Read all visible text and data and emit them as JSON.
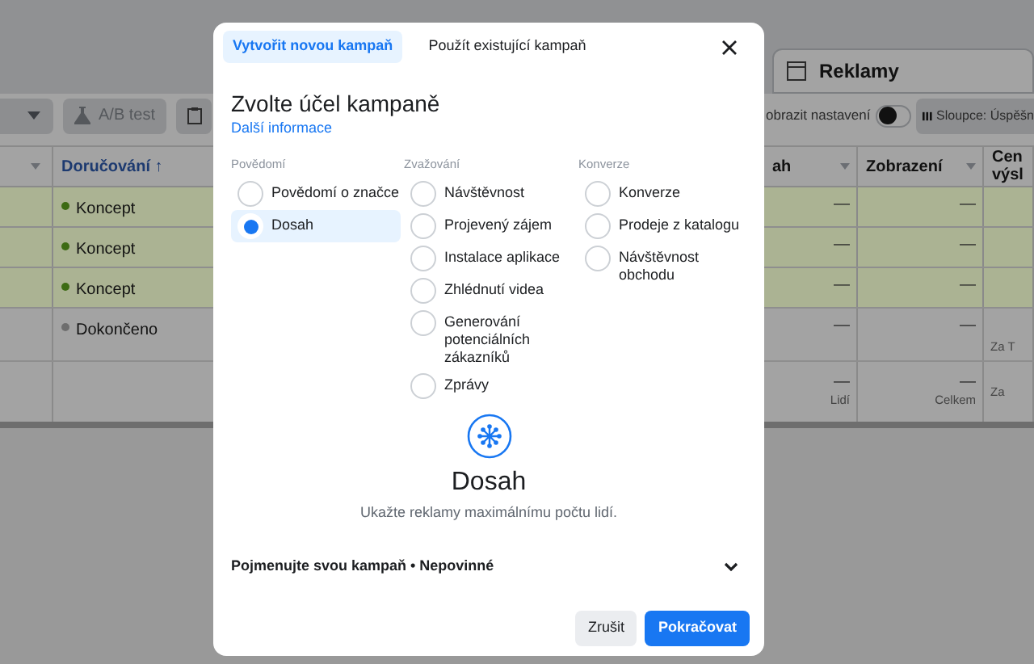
{
  "background": {
    "tab": {
      "label": "Reklamy"
    },
    "toolbar": {
      "ab_test": "A/B test",
      "settings_label": "obrazit nastavení",
      "settings_on": false,
      "columns_button": "Sloupce: Úspěšn"
    },
    "table": {
      "columns": [
        {
          "label": "Doručování ↑",
          "sorted": true
        },
        {
          "label": "ah",
          "sorted": false
        },
        {
          "label": "Zobrazení",
          "sorted": false
        },
        {
          "label": "Cen\nvýsl",
          "sorted": false
        }
      ],
      "rows": [
        {
          "color": "#3d6b14",
          "highlighted": true,
          "cells": [
            "Koncept",
            "—",
            "—",
            ""
          ]
        },
        {
          "color": "#3d6b14",
          "highlighted": true,
          "cells": [
            "Koncept",
            "—",
            "—",
            ""
          ]
        },
        {
          "color": "#3d6b14",
          "highlighted": true,
          "cells": [
            "Koncept",
            "—",
            "—",
            ""
          ]
        },
        {
          "color": "#6e6e6e",
          "highlighted": false,
          "cells": [
            "Dokončeno",
            "—",
            "—",
            "Za T"
          ]
        }
      ],
      "totals": [
        {
          "value": "—",
          "caption": "Lidí"
        },
        {
          "value": "—",
          "caption": "Celkem"
        },
        {
          "caption": "Za"
        }
      ]
    }
  },
  "modal": {
    "tabs": [
      {
        "label": "Vytvořit novou kampaň",
        "selected": true
      },
      {
        "label": "Použít existující kampaň",
        "selected": false
      }
    ],
    "title": "Zvolte účel kampaně",
    "link": "Další informace",
    "groups": [
      {
        "label": "Povědomí",
        "options": [
          {
            "label": "Povědomí o značce",
            "selected": false
          },
          {
            "label": "Dosah",
            "selected": true
          }
        ]
      },
      {
        "label": "Zvažování",
        "options": [
          {
            "label": "Návštěvnost",
            "selected": false
          },
          {
            "label": "Projevený zájem",
            "selected": false
          },
          {
            "label": "Instalace aplikace",
            "selected": false
          },
          {
            "label": "Zhlédnutí videa",
            "selected": false
          },
          {
            "label": "Generování potenciálních zákazníků",
            "selected": false
          },
          {
            "label": "Zprávy",
            "selected": false
          }
        ]
      },
      {
        "label": "Konverze",
        "options": [
          {
            "label": "Konverze",
            "selected": false
          },
          {
            "label": "Prodeje z katalogu",
            "selected": false
          },
          {
            "label": "Návštěvnost obchodu",
            "selected": false
          }
        ]
      }
    ],
    "detail": {
      "title": "Dosah",
      "description": "Ukažte reklamy maximálnímu počtu lidí."
    },
    "name_section": {
      "label": "Pojmenujte svou kampaň • Nepovinné",
      "expanded": false
    },
    "buttons": [
      {
        "label": "Zrušit",
        "kind": "secondary"
      },
      {
        "label": "Pokračovat",
        "kind": "primary"
      }
    ]
  }
}
